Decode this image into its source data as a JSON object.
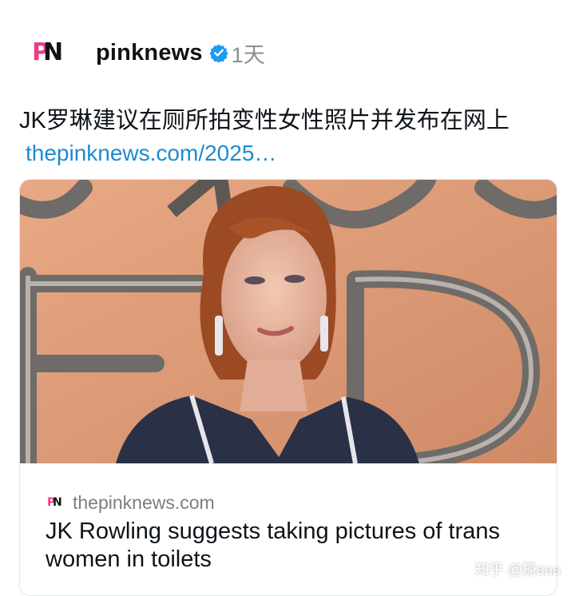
{
  "account": {
    "name": "pinknews",
    "age": "1天",
    "logo_letters": [
      "P",
      "N"
    ],
    "brand_pink": "#ee3b8a",
    "verified_color": "#1d9bf0"
  },
  "post": {
    "text": "JK罗琳建议在厕所拍变性女性照片并发布在网上",
    "link": "thepinknews.com/2025…"
  },
  "card": {
    "domain": "thepinknews.com",
    "title": "JK Rowling suggests taking pictures of trans women in toilets",
    "image_alt": "photo-of-woman-in-front-of-large-letters"
  },
  "watermark": "知乎 @搽aaa"
}
